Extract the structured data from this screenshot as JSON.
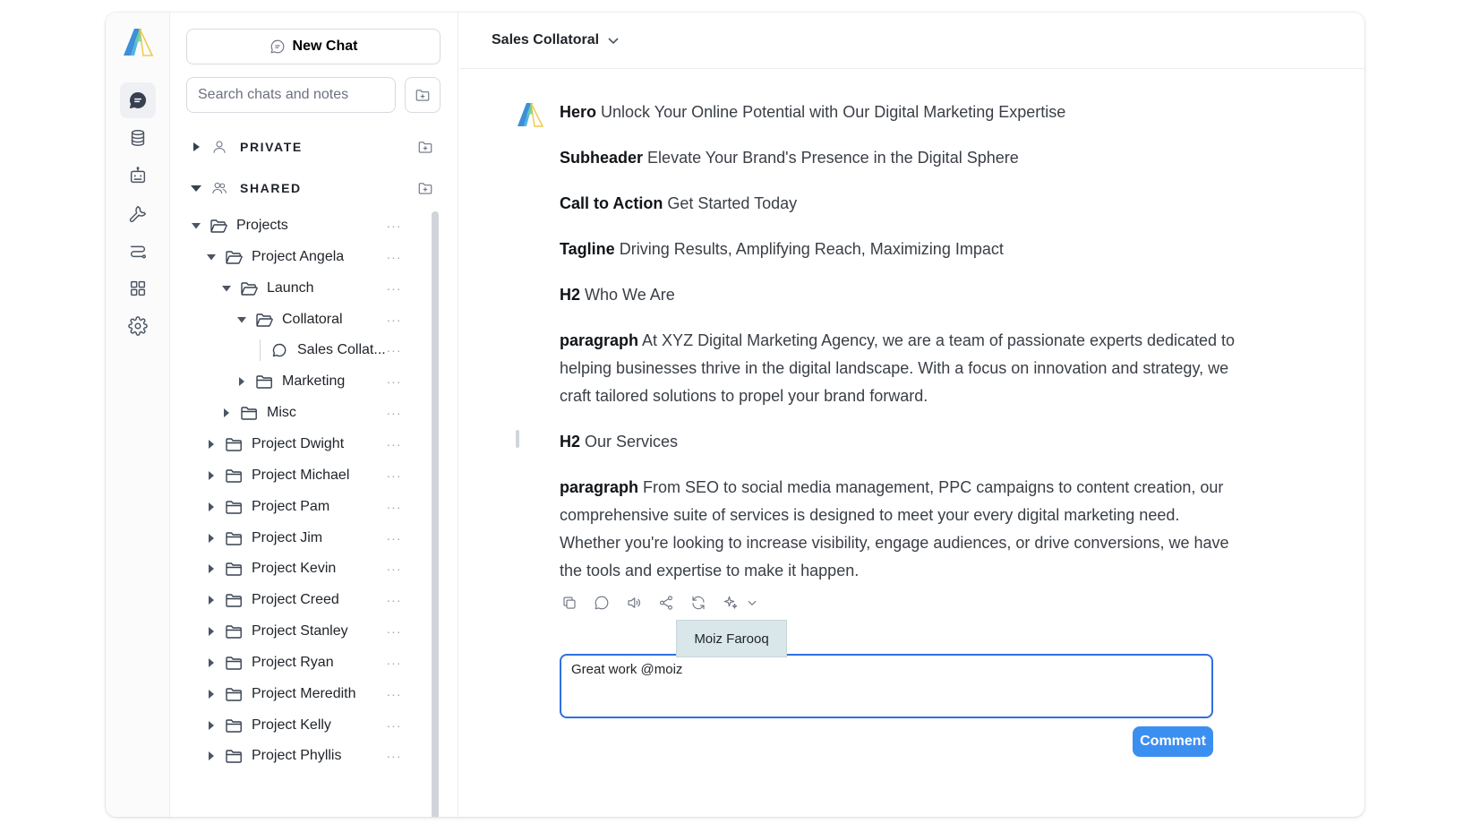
{
  "sidebar": {
    "new_chat_label": "New Chat",
    "search_placeholder": "Search chats and notes",
    "sections": [
      {
        "label": "PRIVATE",
        "expanded": false
      },
      {
        "label": "SHARED",
        "expanded": true
      }
    ],
    "tree": [
      {
        "label": "Projects",
        "depth": 0,
        "expanded": true,
        "type": "folder"
      },
      {
        "label": "Project Angela",
        "depth": 1,
        "expanded": true,
        "type": "folder"
      },
      {
        "label": "Launch",
        "depth": 2,
        "expanded": true,
        "type": "folder"
      },
      {
        "label": "Collatoral",
        "depth": 3,
        "expanded": true,
        "type": "folder"
      },
      {
        "label": "Sales Collat...",
        "depth": 4,
        "expanded": false,
        "type": "chat"
      },
      {
        "label": "Marketing",
        "depth": 3,
        "expanded": false,
        "type": "folder"
      },
      {
        "label": "Misc",
        "depth": 2,
        "expanded": false,
        "type": "folder"
      },
      {
        "label": "Project Dwight",
        "depth": 1,
        "expanded": false,
        "type": "folder"
      },
      {
        "label": "Project Michael",
        "depth": 1,
        "expanded": false,
        "type": "folder"
      },
      {
        "label": "Project Pam",
        "depth": 1,
        "expanded": false,
        "type": "folder"
      },
      {
        "label": "Project Jim",
        "depth": 1,
        "expanded": false,
        "type": "folder"
      },
      {
        "label": "Project Kevin",
        "depth": 1,
        "expanded": false,
        "type": "folder"
      },
      {
        "label": "Project Creed",
        "depth": 1,
        "expanded": false,
        "type": "folder"
      },
      {
        "label": "Project Stanley",
        "depth": 1,
        "expanded": false,
        "type": "folder"
      },
      {
        "label": "Project Ryan",
        "depth": 1,
        "expanded": false,
        "type": "folder"
      },
      {
        "label": "Project Meredith",
        "depth": 1,
        "expanded": false,
        "type": "folder"
      },
      {
        "label": "Project Kelly",
        "depth": 1,
        "expanded": false,
        "type": "folder"
      },
      {
        "label": "Project Phyllis",
        "depth": 1,
        "expanded": false,
        "type": "folder"
      }
    ],
    "more_label": "···"
  },
  "rail": {
    "icons": [
      "chat-icon",
      "database-icon",
      "bot-icon",
      "wrench-icon",
      "route-icon",
      "grid-icon",
      "gear-icon"
    ]
  },
  "header": {
    "title": "Sales Collatoral"
  },
  "message": {
    "blocks": [
      {
        "tag": "Hero",
        "text": "Unlock Your Online Potential with Our Digital Marketing Expertise"
      },
      {
        "tag": "Subheader",
        "text": "Elevate Your Brand's Presence in the Digital Sphere"
      },
      {
        "tag": "Call to Action",
        "text": "Get Started Today"
      },
      {
        "tag": "Tagline",
        "text": "Driving Results, Amplifying Reach, Maximizing Impact"
      },
      {
        "tag": "H2",
        "text": "Who We Are"
      },
      {
        "tag": "paragraph",
        "text": "At XYZ Digital Marketing Agency, we are a team of passionate experts dedicated to helping businesses thrive in the digital landscape. With a focus on innovation and strategy, we craft tailored solutions to propel your brand forward."
      },
      {
        "tag": "H2",
        "text": "Our Services"
      },
      {
        "tag": "paragraph",
        "text": "From SEO to social media management, PPC campaigns to content creation, our comprehensive suite of services is designed to meet your every digital marketing need. Whether you're looking to increase visibility, engage audiences, or drive conversions, we have the tools and expertise to make it happen."
      }
    ]
  },
  "comment": {
    "mention_suggestion": "Moiz Farooq",
    "value": "Great work @moiz",
    "button_label": "Comment"
  },
  "colors": {
    "accent": "#2f6fe4",
    "button": "#3b8ff0",
    "mention_bg": "#d9e7ea"
  }
}
